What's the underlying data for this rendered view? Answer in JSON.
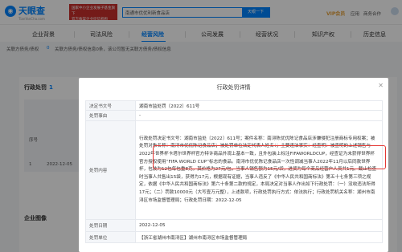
{
  "header": {
    "logo_icon": "eye-logo-icon",
    "logo_text": "天眼查",
    "logo_sub": "TianYanCha.com",
    "promo_line1": "国家中小企业发展子基金旗下",
    "promo_line2": "官方备案企业征信机构",
    "search_value": "南通市优优利新食品店",
    "search_button": "天眼一下",
    "vip_label": "VIP会员",
    "nav_links": [
      "应用",
      "商务合作",
      "百度编辑"
    ],
    "user_name": "用户"
  },
  "tabs": [
    "企业背景",
    "司法风险",
    "经营风险",
    "公司发展",
    "经营状况",
    "知识产权",
    "历史信息"
  ],
  "active_tab_index": 2,
  "riskbar": {
    "item1": "关联方债务/债权",
    "item1_value": "0",
    "item2": "关联方债务/债权信息0条，该公司暂无关联方债务/债权信息"
  },
  "background": {
    "section_title": "行政处罚",
    "section_count": "1",
    "col_label": "序号",
    "row_num": "1",
    "row_date": "2022-12-05",
    "section2_title": "企业图像"
  },
  "modal": {
    "title": "行政处罚详情",
    "close_icon": "close-icon",
    "rows": [
      {
        "k": "决定书文号",
        "v": "湖南市监处罚〔2022〕611号"
      },
      {
        "k": "处罚事由",
        "v": "-"
      },
      {
        "k": "处罚内容",
        "v_before": "行政处罚决定书文号：湖南市监处〔2022〕611号；案件名称：南浔陈优优陈记食品店涉嫌侵犯注册商标专用权案；被处罚对象名称：南浔市优优陈记食品店；被处罚单位法定代表人姓名：；主要违法事实：经查明：",
        "v_highlight": "被查明的上述销售与2022年世界杯卡塔尔世界杯官方特许商品外观上基本一致，且外包装上标注FIFAWORLDCUP，经查证为未获得世界杯官方授权使用“FIFA WORLD CUP”标志的食品。",
        "v_after": "南浔市优优陈记食品店一次性调减当事人2022年11月以后同款世界杯，包装为12包每包重8克，其价格为27元/包，当事人销售额为15元/袋，进货为每个商品经营户人员共1元。截止检查时当事人共售出15袋，获得为17元，根据现有证据，当事人违反了《中华人民共和国商标法》第五十七条第三项之规定，依据《中华人民共和国商标法》第六十条第二款的规定，本局决定对当事人作出如下行政处罚：（一）没收违法所得17元；（二）罚款10000元（大写壹万元整），上述款项，行政处罚执行方式：依法执行；行政处罚机关名称：湖州市南浔区市场监督管理局；行政处罚日期：2022-12-05"
      },
      {
        "k": "处罚日期",
        "v": "2022-12-05"
      },
      {
        "k": "处罚单位",
        "v": "【浙江省湖州市南浔区】湖州市南浔区市场监督管理局"
      }
    ]
  }
}
